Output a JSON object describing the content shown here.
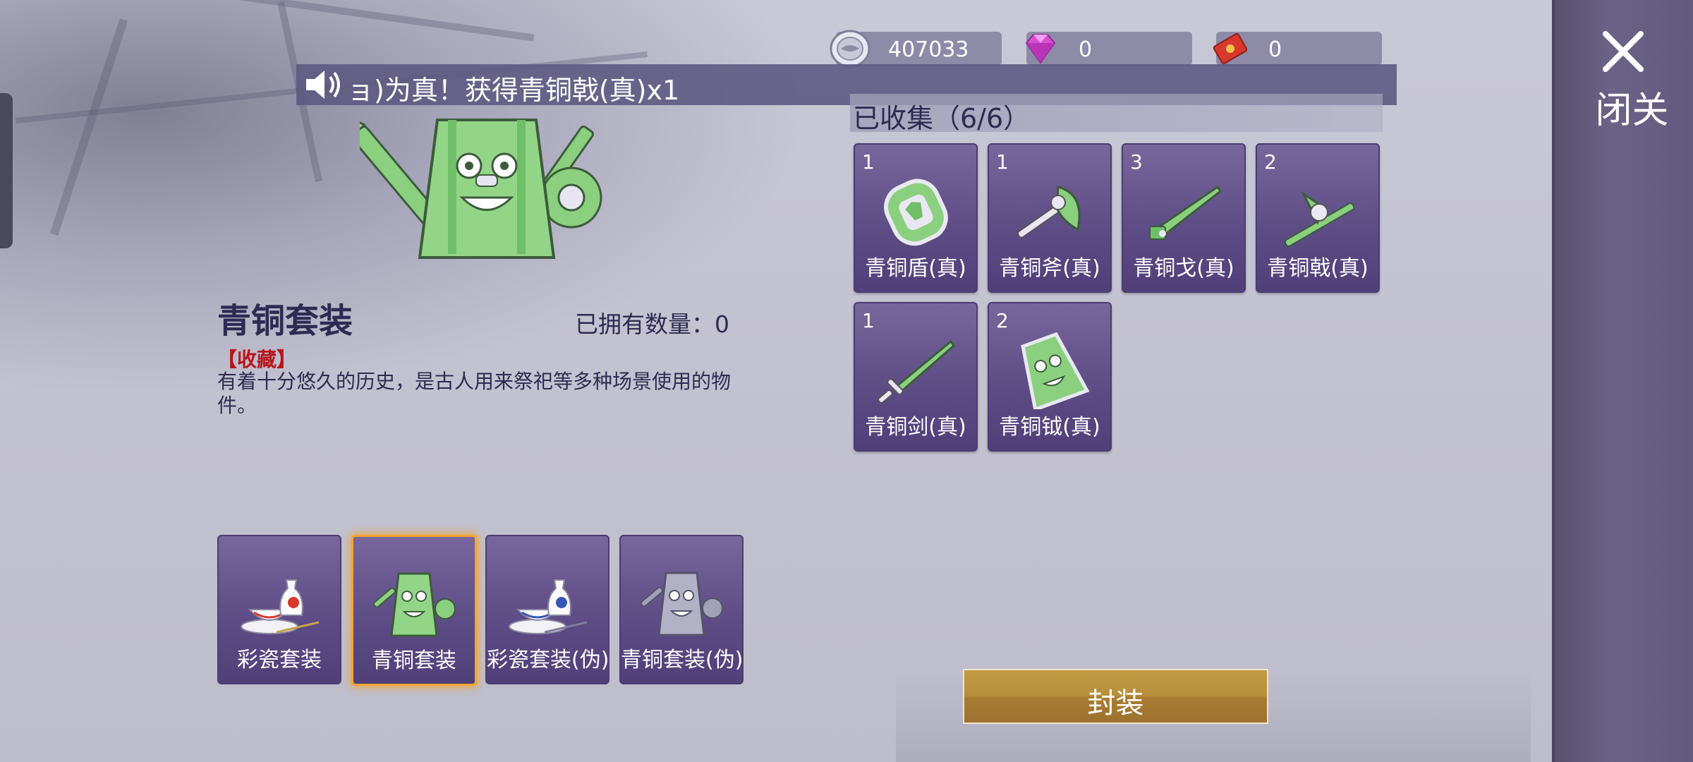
{
  "currencies": [
    {
      "icon": "silver-coin-icon",
      "value": "407033"
    },
    {
      "icon": "gem-icon",
      "value": "0"
    },
    {
      "icon": "red-ticket-icon",
      "value": "0"
    }
  ],
  "marquee": {
    "text": "ョ)为真！获得青铜戟(真)x1"
  },
  "close": {
    "label": "关闭"
  },
  "detail": {
    "title": "青铜套装",
    "owned_label": "已拥有数量：0",
    "tag": "【收藏】",
    "description": "有着十分悠久的历史，是古人用来祭祀等多种场景使用的物件。"
  },
  "collection": {
    "header": "已收集（6/6）",
    "items": [
      {
        "count": "1",
        "name": "青铜盾(真)",
        "icon": "bronze-shield-icon"
      },
      {
        "count": "1",
        "name": "青铜斧(真)",
        "icon": "bronze-axe-icon"
      },
      {
        "count": "3",
        "name": "青铜戈(真)",
        "icon": "bronze-dagger-axe-icon"
      },
      {
        "count": "2",
        "name": "青铜戟(真)",
        "icon": "bronze-halberd-icon"
      },
      {
        "count": "1",
        "name": "青铜剑(真)",
        "icon": "bronze-sword-icon"
      },
      {
        "count": "2",
        "name": "青铜钺(真)",
        "icon": "bronze-battle-axe-icon"
      }
    ]
  },
  "sets": [
    {
      "name": "彩瓷套装",
      "icon": "porcelain-set-icon",
      "selected": false
    },
    {
      "name": "青铜套装",
      "icon": "bronze-set-icon",
      "selected": true
    },
    {
      "name": "彩瓷套装(伪)",
      "icon": "porcelain-set-fake-icon",
      "selected": false
    },
    {
      "name": "青铜套装(伪)",
      "icon": "bronze-set-fake-icon",
      "selected": false
    }
  ],
  "seal_button": {
    "label": "封装"
  },
  "colors": {
    "accent": "#f2a531",
    "card": "#5c4b84",
    "button": "#b88f3b",
    "tag": "#b8141b"
  }
}
